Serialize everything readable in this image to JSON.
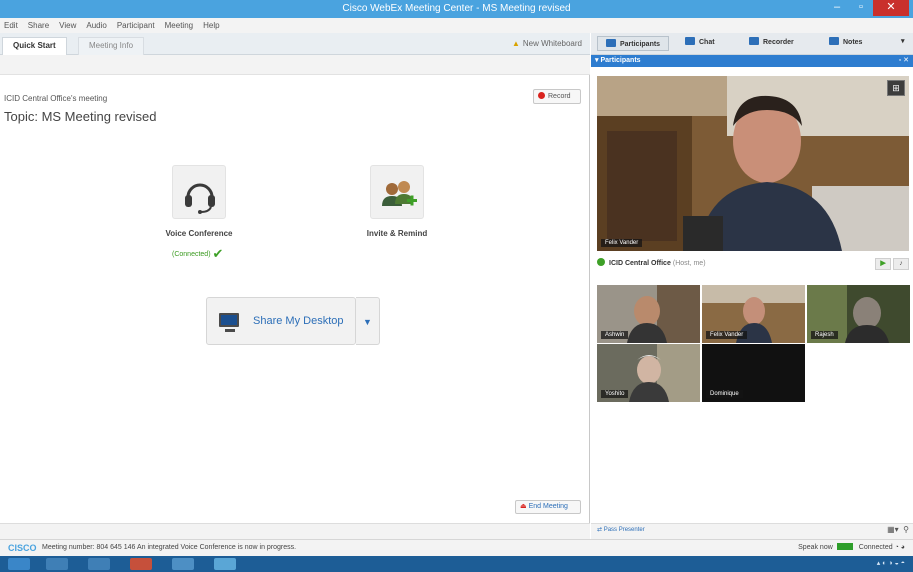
{
  "window": {
    "title": "Cisco WebEx Meeting Center - MS Meeting revised"
  },
  "menubar": [
    "Edit",
    "Share",
    "View",
    "Audio",
    "Participant",
    "Meeting",
    "Help"
  ],
  "left": {
    "tabs": [
      "Quick Start",
      "Meeting Info"
    ],
    "new_whiteboard": "New Whiteboard",
    "meeting_name": "ICID Central Office's meeting",
    "topic": "Topic:  MS Meeting revised",
    "record": "Record",
    "voice_label": "Voice Conference",
    "voice_status": "(Connected)",
    "invite_label": "Invite & Remind",
    "share_label": "Share My Desktop",
    "end_meeting": "End Meeting"
  },
  "right": {
    "tabs": [
      "Participants",
      "Chat",
      "Recorder",
      "Notes"
    ],
    "panel_header": "Participants",
    "main_video_name": "Felix Vander",
    "center_name": "ICID Central Office",
    "center_sub": "(Host, me)",
    "thumbs": [
      {
        "name": "Ashwin"
      },
      {
        "name": "Felix Vander"
      },
      {
        "name": "Rajesh"
      },
      {
        "name": "Yoshito"
      },
      {
        "name": "Dominique"
      }
    ],
    "pass_presenter": "Pass Presenter"
  },
  "status": {
    "logo": "CISCO",
    "message": "Meeting number: 804 645 146    An integrated Voice Conference is now in progress.",
    "speak": "Speak now",
    "connected": "Connected"
  },
  "colors": {
    "title_blue": "#4aa3df",
    "accent_blue": "#2e7dd0",
    "ok_green": "#3ea027",
    "record_red": "#d9231e"
  }
}
